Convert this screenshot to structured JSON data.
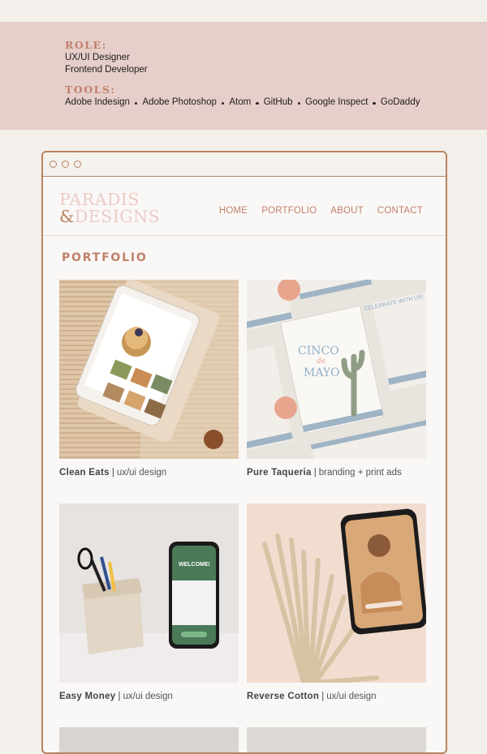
{
  "role": {
    "heading": "ROLE:",
    "lines": [
      "UX/UI Designer",
      "Frontend Developer"
    ]
  },
  "tools": {
    "heading": "TOOLS:",
    "items": [
      "Adobe Indesign",
      "Adobe Photoshop",
      "Atom",
      "GitHub",
      "Google Inspect",
      "GoDaddy"
    ]
  },
  "site": {
    "logo_line1": "PARADIS",
    "logo_amp": "&",
    "logo_line2": "DESIGNS",
    "nav": [
      "HOME",
      "PORTFOLIO",
      "ABOUT",
      "CONTACT"
    ],
    "section_title": "PORTFOLIO",
    "projects": [
      {
        "name": "Clean Eats",
        "sep": "|",
        "category": "ux/ui design"
      },
      {
        "name": "Pure Taqueria",
        "sep": "|",
        "category": "branding + print ads"
      },
      {
        "name": "Easy Money",
        "sep": "|",
        "category": "ux/ui design"
      },
      {
        "name": "Reverse Cotton",
        "sep": "|",
        "category": "ux/ui design"
      }
    ]
  },
  "thumb_text": {
    "cinco": "CINCO",
    "de": "de",
    "mayo": "MAYO",
    "celebrate": "CELEBRATE WITH US!",
    "welcome": "WELCOME!"
  },
  "colors": {
    "band": "#e6ceca",
    "accent": "#c0806a",
    "frame": "#b8845f",
    "page": "#f3efea"
  }
}
